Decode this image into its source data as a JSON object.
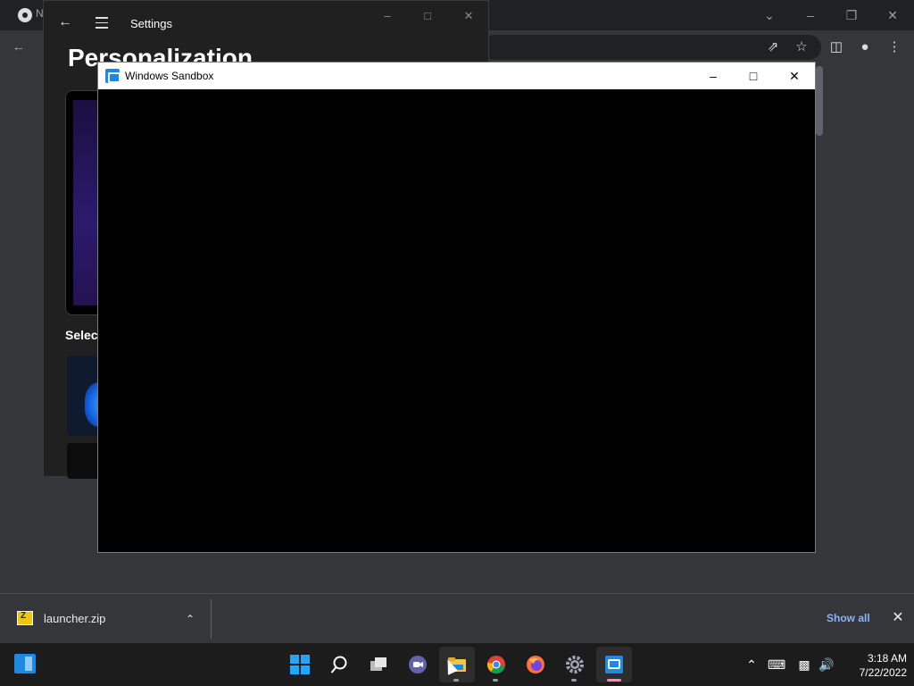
{
  "chrome": {
    "tab_partial_label": "N"
  },
  "settings": {
    "title": "Settings",
    "heading": "Personalization",
    "section_label": "Select"
  },
  "sandbox": {
    "title": "Windows Sandbox"
  },
  "download_shelf": {
    "file_name": "launcher.zip",
    "show_all_label": "Show all"
  },
  "taskbar": {
    "apps": [
      "start",
      "search",
      "task-view",
      "chat",
      "file-explorer",
      "chrome",
      "firefox",
      "settings",
      "windows-sandbox"
    ],
    "time": "3:18 AM",
    "date": "7/22/2022"
  },
  "icons": {
    "back": "arrow-left-icon",
    "menu": "hamburger-icon",
    "minimize": "minimize-icon",
    "maximize": "maximize-icon",
    "close": "close-icon",
    "share": "share-icon",
    "star": "star-icon",
    "profile": "profile-icon"
  }
}
